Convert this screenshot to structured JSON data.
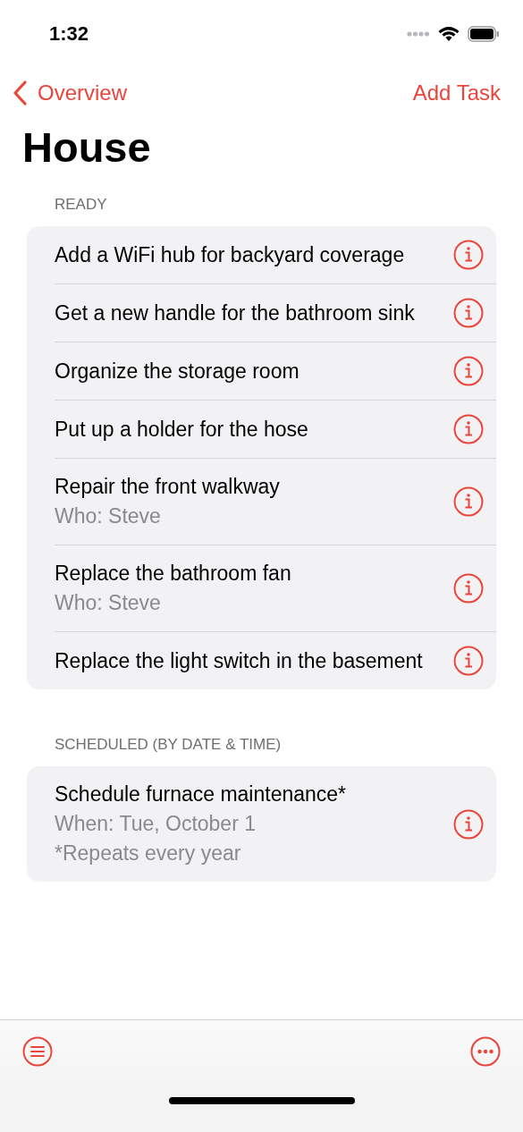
{
  "status_bar": {
    "time": "1:32"
  },
  "nav": {
    "back": "Overview",
    "action": "Add Task"
  },
  "title": "House",
  "sections": [
    {
      "header": "READY",
      "rows": [
        {
          "title": "Add a WiFi hub for backyard coverage",
          "details": []
        },
        {
          "title": "Get a new handle for the bathroom sink",
          "details": []
        },
        {
          "title": "Organize the storage room",
          "details": []
        },
        {
          "title": "Put up a holder for the hose",
          "details": []
        },
        {
          "title": "Repair the front walkway",
          "details": [
            "Who: Steve"
          ]
        },
        {
          "title": "Replace the bathroom fan",
          "details": [
            "Who: Steve"
          ]
        },
        {
          "title": "Replace the light switch in the basement",
          "details": []
        }
      ]
    },
    {
      "header": "SCHEDULED (BY DATE & TIME)",
      "rows": [
        {
          "title": "Schedule furnace maintenance*",
          "details": [
            "When: Tue, October 1",
            "*Repeats every year"
          ]
        }
      ]
    }
  ]
}
